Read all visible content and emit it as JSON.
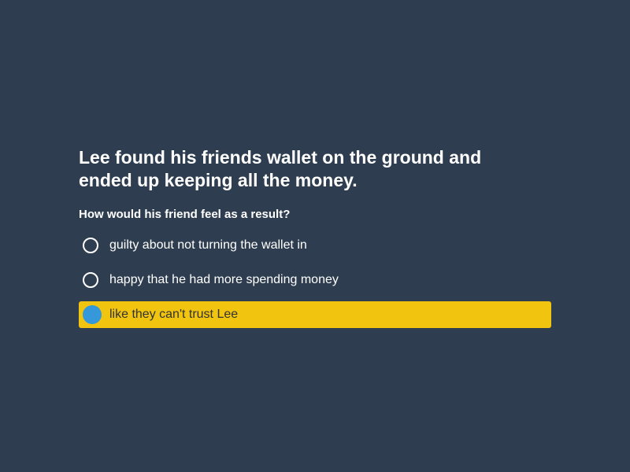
{
  "question": {
    "text": "Lee found his friends wallet on the ground and ended up keeping all the money.",
    "prompt": "How would his friend feel as a result?"
  },
  "options": [
    {
      "label": "guilty about not turning the wallet in",
      "selected": false
    },
    {
      "label": "happy that he had more spending money",
      "selected": false
    },
    {
      "label": "like they can't trust Lee",
      "selected": true
    }
  ],
  "colors": {
    "background": "#2e3e50",
    "selected_row": "#f1c40f",
    "selected_radio": "#3498db",
    "text": "#ffffff"
  }
}
